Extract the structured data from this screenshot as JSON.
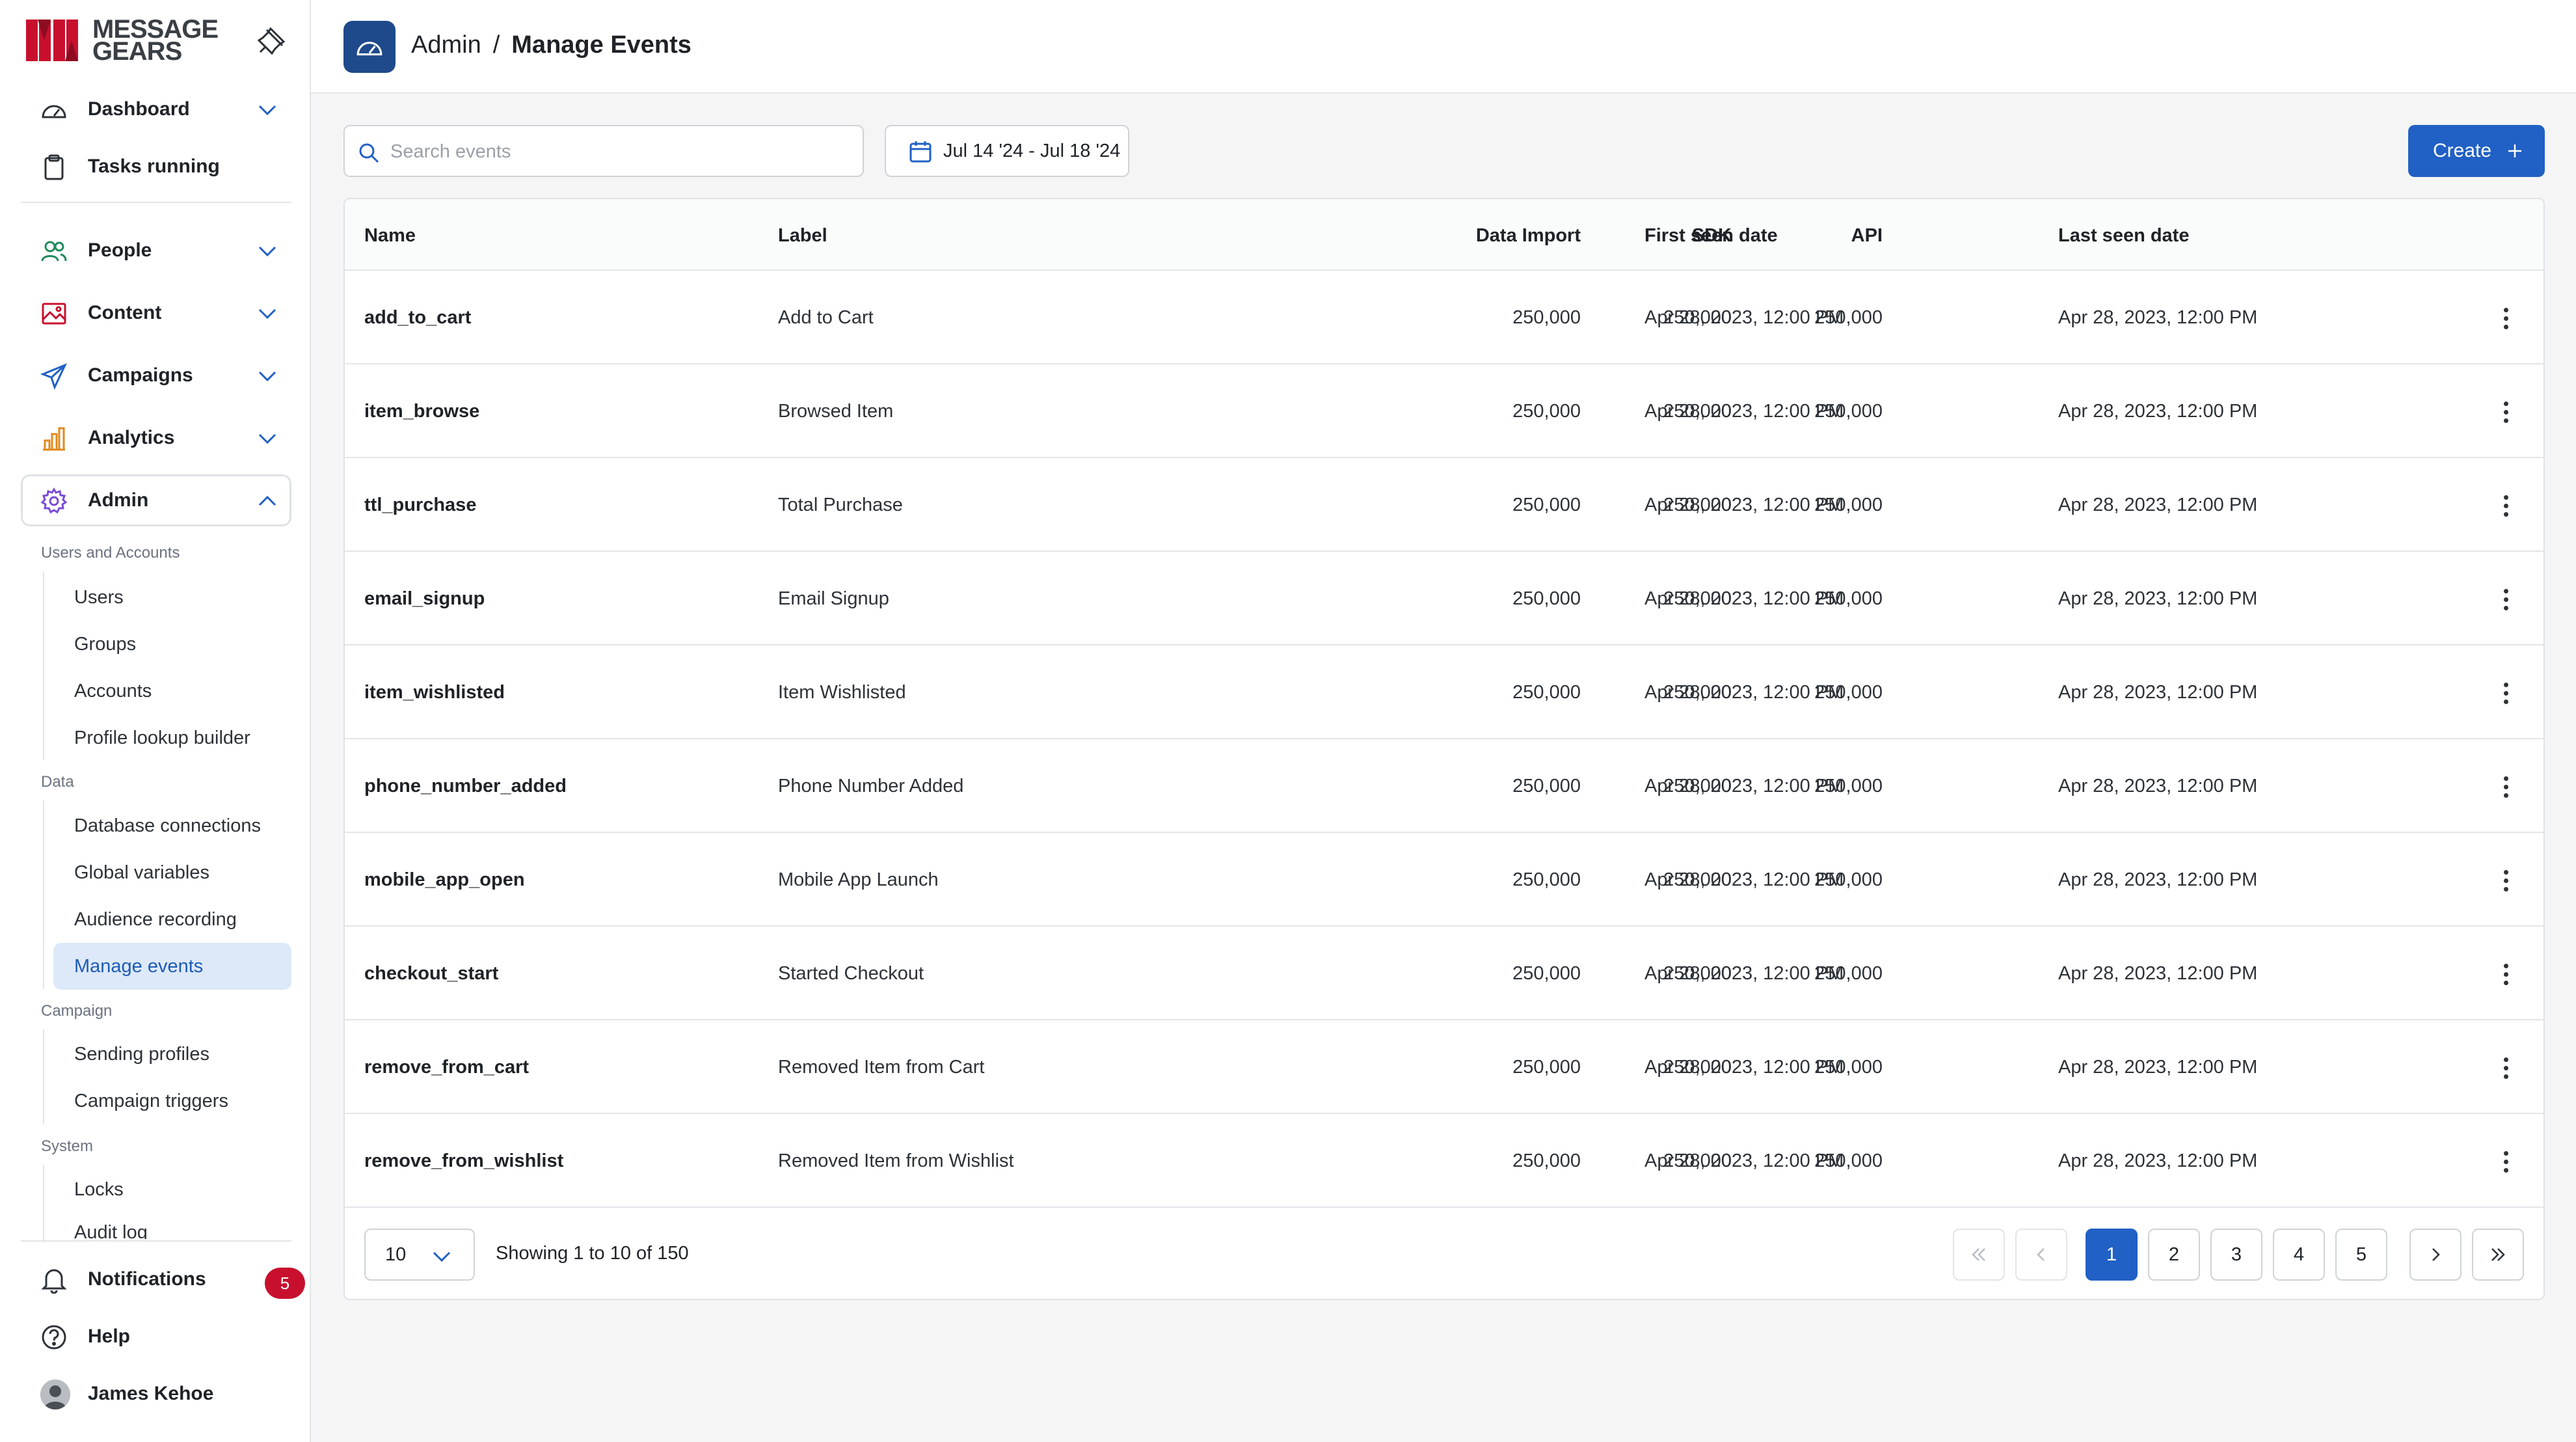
{
  "brand": {
    "line1": "MESSAGE",
    "line2": "GEARS",
    "accent": "#c8102e"
  },
  "sidebar": {
    "top_items": [
      {
        "label": "Dashboard",
        "icon": "dashboard-gauge-icon"
      },
      {
        "label": "Tasks running",
        "icon": "clipboard-icon"
      }
    ],
    "main_items": [
      {
        "label": "People",
        "icon": "people-icon"
      },
      {
        "label": "Content",
        "icon": "image-icon"
      },
      {
        "label": "Campaigns",
        "icon": "paper-plane-icon"
      },
      {
        "label": "Analytics",
        "icon": "bar-chart-icon"
      },
      {
        "label": "Admin",
        "icon": "gear-icon"
      }
    ],
    "groups": {
      "users": {
        "label": "Users and Accounts",
        "items": [
          "Users",
          "Groups",
          "Accounts",
          "Profile lookup builder"
        ]
      },
      "data": {
        "label": "Data",
        "items": [
          "Database connections",
          "Global variables",
          "Audience recording",
          "Manage events"
        ]
      },
      "campaign": {
        "label": "Campaign",
        "items": [
          "Sending profiles",
          "Campaign triggers"
        ]
      },
      "system": {
        "label": "System",
        "items": [
          "Locks",
          "Audit log"
        ]
      }
    },
    "active_item": "Manage events",
    "bottom": {
      "notifications": {
        "label": "Notifications",
        "count": "5"
      },
      "help": {
        "label": "Help"
      },
      "user": {
        "name": "James Kehoe"
      }
    }
  },
  "header": {
    "breadcrumb_root": "Admin",
    "breadcrumb_sep": "/",
    "title": "Manage Events"
  },
  "toolbar": {
    "search_placeholder": "Search events",
    "date_range": "Jul 14 '24 - Jul 18 '24",
    "create_label": "Create"
  },
  "table": {
    "columns": [
      "Name",
      "Label",
      "Data Import",
      "SDK",
      "API",
      "First seen date",
      "Last seen date"
    ],
    "rows": [
      {
        "name": "add_to_cart",
        "label": "Add to Cart",
        "data_import": "250,000",
        "sdk": "250,000",
        "api": "250,000",
        "first_seen": "Apr 28, 2023, 12:00 PM",
        "last_seen": "Apr 28, 2023, 12:00 PM"
      },
      {
        "name": "item_browse",
        "label": "Browsed Item",
        "data_import": "250,000",
        "sdk": "250,000",
        "api": "250,000",
        "first_seen": "Apr 28, 2023, 12:00 PM",
        "last_seen": "Apr 28, 2023, 12:00 PM"
      },
      {
        "name": "ttl_purchase",
        "label": "Total Purchase",
        "data_import": "250,000",
        "sdk": "250,000",
        "api": "250,000",
        "first_seen": "Apr 28, 2023, 12:00 PM",
        "last_seen": "Apr 28, 2023, 12:00 PM"
      },
      {
        "name": "email_signup",
        "label": "Email Signup",
        "data_import": "250,000",
        "sdk": "250,000",
        "api": "250,000",
        "first_seen": "Apr 28, 2023, 12:00 PM",
        "last_seen": "Apr 28, 2023, 12:00 PM"
      },
      {
        "name": "item_wishlisted",
        "label": "Item Wishlisted",
        "data_import": "250,000",
        "sdk": "250,000",
        "api": "250,000",
        "first_seen": "Apr 28, 2023, 12:00 PM",
        "last_seen": "Apr 28, 2023, 12:00 PM"
      },
      {
        "name": "phone_number_added",
        "label": "Phone Number Added",
        "data_import": "250,000",
        "sdk": "250,000",
        "api": "250,000",
        "first_seen": "Apr 28, 2023, 12:00 PM",
        "last_seen": "Apr 28, 2023, 12:00 PM"
      },
      {
        "name": "mobile_app_open",
        "label": "Mobile App Launch",
        "data_import": "250,000",
        "sdk": "250,000",
        "api": "250,000",
        "first_seen": "Apr 28, 2023, 12:00 PM",
        "last_seen": "Apr 28, 2023, 12:00 PM"
      },
      {
        "name": "checkout_start",
        "label": "Started Checkout",
        "data_import": "250,000",
        "sdk": "250,000",
        "api": "250,000",
        "first_seen": "Apr 28, 2023, 12:00 PM",
        "last_seen": "Apr 28, 2023, 12:00 PM"
      },
      {
        "name": "remove_from_cart",
        "label": "Removed Item from Cart",
        "data_import": "250,000",
        "sdk": "250,000",
        "api": "250,000",
        "first_seen": "Apr 28, 2023, 12:00 PM",
        "last_seen": "Apr 28, 2023, 12:00 PM"
      },
      {
        "name": "remove_from_wishlist",
        "label": "Removed Item from Wishlist",
        "data_import": "250,000",
        "sdk": "250,000",
        "api": "250,000",
        "first_seen": "Apr 28, 2023, 12:00 PM",
        "last_seen": "Apr 28, 2023, 12:00 PM"
      }
    ]
  },
  "pagination": {
    "per_page": "10",
    "showing": "Showing 1 to 10 of 150",
    "pages": [
      "1",
      "2",
      "3",
      "4",
      "5"
    ],
    "current_page": "1"
  },
  "colors": {
    "primary": "#2160c4",
    "header_icon_bg": "#1e4a8c",
    "active_bg": "#dde9f8",
    "badge": "#c8102e"
  }
}
